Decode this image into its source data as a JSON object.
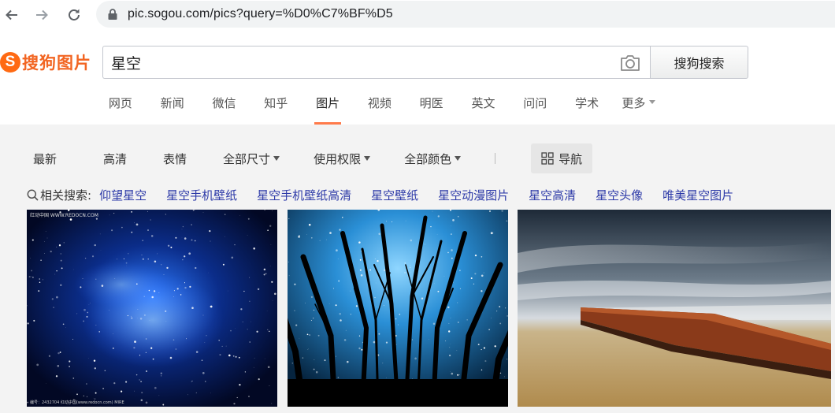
{
  "browser": {
    "back_icon": "arrow-left-icon",
    "forward_icon": "arrow-right-icon",
    "reload_icon": "reload-icon",
    "lock_icon": "lock-icon",
    "url": "pic.sogou.com/pics?query=%D0%C7%BF%D5"
  },
  "header": {
    "logo_mark": "S",
    "logo_text": "搜狗图片",
    "search_value": "星空",
    "camera_icon": "camera-icon",
    "search_button": "搜狗搜索"
  },
  "tabs": [
    {
      "label": "网页",
      "active": false
    },
    {
      "label": "新闻",
      "active": false
    },
    {
      "label": "微信",
      "active": false
    },
    {
      "label": "知乎",
      "active": false
    },
    {
      "label": "图片",
      "active": true
    },
    {
      "label": "视频",
      "active": false
    },
    {
      "label": "明医",
      "active": false
    },
    {
      "label": "英文",
      "active": false
    },
    {
      "label": "问问",
      "active": false
    },
    {
      "label": "学术",
      "active": false
    },
    {
      "label": "更多",
      "active": false,
      "dropdown": true
    }
  ],
  "filters": {
    "latest": "最新",
    "hd": "高清",
    "emoji": "表情",
    "size": "全部尺寸",
    "rights": "使用权限",
    "color": "全部颜色",
    "nav": "导航",
    "nav_icon": "grid-icon"
  },
  "related": {
    "label": "相关搜索:",
    "search_icon": "search-icon",
    "links": [
      "仰望星空",
      "星空手机壁纸",
      "星空手机壁纸高清",
      "星空壁纸",
      "星空动漫图片",
      "星空高清",
      "星空头像",
      "唯美星空图片"
    ]
  },
  "images": [
    {
      "name": "starry-nebula-image",
      "watermark_top": "红动中国 WWW.REDOCN.COM",
      "watermark_bottom": "编号：2432704  红动中国(www.redocn.com)  MIRE"
    },
    {
      "name": "forest-starry-sky-image"
    },
    {
      "name": "pier-long-exposure-image"
    }
  ]
}
